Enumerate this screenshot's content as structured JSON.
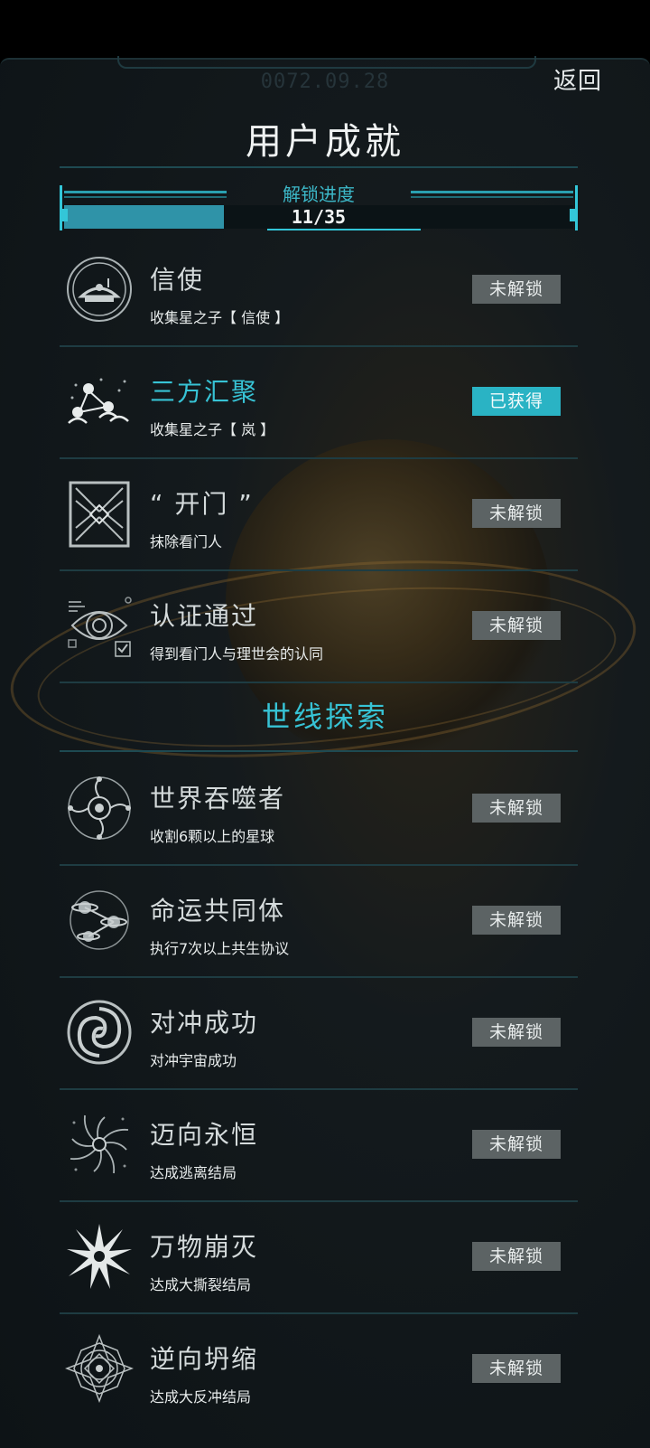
{
  "header": {
    "date": "0072.09.28",
    "back_label": "返回",
    "title": "用户成就"
  },
  "progress": {
    "label": "解锁进度",
    "unlocked": 11,
    "total": 35,
    "count_text": "11/35",
    "fraction": 0.314
  },
  "section_title": "世线探索",
  "colors": {
    "accent": "#37c3d5",
    "locked_badge": "#5c6364",
    "unlocked_badge": "#2ab3c4",
    "background": "#101619"
  },
  "achievements": [
    {
      "name": "信使",
      "desc": "收集星之子【 信使 】",
      "status": "未解锁",
      "unlocked": false,
      "icon": "satellite-dish-icon"
    },
    {
      "name": "三方汇聚",
      "desc": "收集星之子【 岚 】",
      "status": "已获得",
      "unlocked": true,
      "icon": "three-figures-network-icon"
    },
    {
      "name": "“ 开门 ”",
      "desc": "抹除看门人",
      "status": "未解锁",
      "unlocked": false,
      "icon": "gate-icon"
    },
    {
      "name": "认证通过",
      "desc": "得到看门人与理世会的认同",
      "status": "未解锁",
      "unlocked": false,
      "icon": "eye-verify-icon"
    },
    {
      "name": "世界吞噬者",
      "desc": "收割6颗以上的星球",
      "status": "未解锁",
      "unlocked": false,
      "icon": "orbit-eye-icon"
    },
    {
      "name": "命运共同体",
      "desc": "执行7次以上共生协议",
      "status": "未解锁",
      "unlocked": false,
      "icon": "linked-planets-icon"
    },
    {
      "name": "对冲成功",
      "desc": "对冲宇宙成功",
      "status": "未解锁",
      "unlocked": false,
      "icon": "spiral-icon"
    },
    {
      "name": "迈向永恒",
      "desc": "达成逃离结局",
      "status": "未解锁",
      "unlocked": false,
      "icon": "vortex-icon"
    },
    {
      "name": "万物崩灭",
      "desc": "达成大撕裂结局",
      "status": "未解锁",
      "unlocked": false,
      "icon": "starburst-icon"
    },
    {
      "name": "逆向坍缩",
      "desc": "达成大反冲结局",
      "status": "未解锁",
      "unlocked": false,
      "icon": "mandala-icon"
    }
  ]
}
